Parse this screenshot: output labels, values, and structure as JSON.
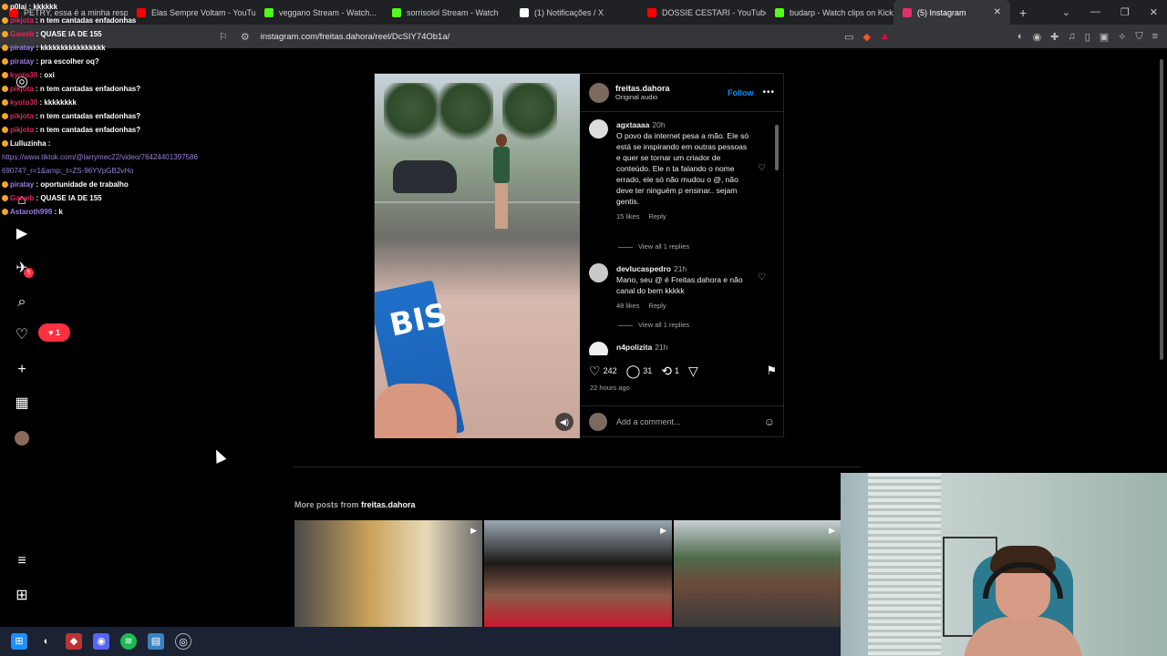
{
  "tabs": [
    {
      "label": "PETRY, essa é a minha respo...",
      "color": "#ff0000"
    },
    {
      "label": "Elas Sempre Voltam - YouTube",
      "color": "#ff0000"
    },
    {
      "label": "veggano Stream - Watch...",
      "color": "#53fc18"
    },
    {
      "label": "sorrisolol Stream - Watch",
      "color": "#53fc18"
    },
    {
      "label": "(1) Notificações / X",
      "color": "#ffffff"
    },
    {
      "label": "DOSSIE CESTARI - YouTube",
      "color": "#ff0000"
    },
    {
      "label": "budarp - Watch clips on Kick",
      "color": "#53fc18"
    },
    {
      "label": "(5) Instagram",
      "color": "#e1306c"
    }
  ],
  "address": {
    "url": "instagram.com/freitas.dahora/reel/DcSIY74Ob1a/"
  },
  "chat": [
    {
      "user": "p0lai",
      "color": "#ffffff",
      "msg": "kkkkkk"
    },
    {
      "user": "pikjota",
      "color": "#e0245e",
      "msg": "n tem cantadas enfadonhas"
    },
    {
      "user": "Gaweb",
      "color": "#e0245e",
      "msg": "QUASE IA DE 155"
    },
    {
      "user": "pirataу",
      "color": "#9b7fe0",
      "msg": "kkkkkkkkkkkkkkkk"
    },
    {
      "user": "pirataу",
      "color": "#9b7fe0",
      "msg": "pra escolher oq?"
    },
    {
      "user": "kyoto30",
      "color": "#e0245e",
      "msg": "oxi"
    },
    {
      "user": "pikjota",
      "color": "#e0245e",
      "msg": "n tem cantadas enfadonhas?"
    },
    {
      "user": "kyoto30",
      "color": "#e0245e",
      "msg": "kkkkkkkk"
    },
    {
      "user": "pikjota",
      "color": "#e0245e",
      "msg": "n tem cantadas enfadonhas?"
    },
    {
      "user": "pikjota",
      "color": "#e0245e",
      "msg": "n tem cantadas enfadonhas?"
    },
    {
      "user": "Lulluzinha",
      "color": "#ffffff",
      "msg": ""
    },
    {
      "user": "",
      "color": "#9b7fe0",
      "msg": "https://www.tiktok.com/@larrymec22/video/76424401397586",
      "link": true
    },
    {
      "user": "",
      "color": "#9b7fe0",
      "msg": "69074?_r=1&amp;_t=ZS-96YVpGB2vHo",
      "link": true
    },
    {
      "user": "pirataу",
      "color": "#9b7fe0",
      "msg": "oportunidade de trabalho"
    },
    {
      "user": "Gaweb",
      "color": "#e0245e",
      "msg": "QUASE IA DE 155"
    },
    {
      "user": "Astaroth999",
      "color": "#9b7fe0",
      "msg": "k"
    }
  ],
  "sidebar": {
    "notif_count": "5",
    "like_count": "1"
  },
  "post": {
    "username": "freitas.dahora",
    "audio": "Original audio",
    "follow_label": "Follow",
    "more_label": "•••",
    "video_text": "BIS",
    "comments": [
      {
        "user": "agxtaaaa",
        "time": "20h",
        "text": "O povo da internet pesa a mão. Ele só está se inspirando em outras pessoas e quer se tornar um criador de conteúdo. Ele n ta falando o nome errado, ele só não mudou o @, não deve ter ninguém p ensinar.. sejam gentis.",
        "likes": "15 likes",
        "reply": "Reply",
        "view": "View all 1 replies"
      },
      {
        "user": "devlucaspedro",
        "time": "21h",
        "text": "Mano, seu @ é Freitas.dahora e não canal do bem kkkkk",
        "likes": "48 likes",
        "reply": "Reply",
        "view": "View all 1 replies"
      },
      {
        "user": "n4polizita",
        "time": "21h",
        "text": "",
        "likes": "",
        "reply": "",
        "view": ""
      }
    ],
    "likes": "242",
    "comments_count": "31",
    "reposts": "1",
    "time_ago": "22 hours ago",
    "comment_placeholder": "Add a comment..."
  },
  "more_posts": {
    "prefix": "More posts from",
    "user": "freitas.dahora"
  }
}
